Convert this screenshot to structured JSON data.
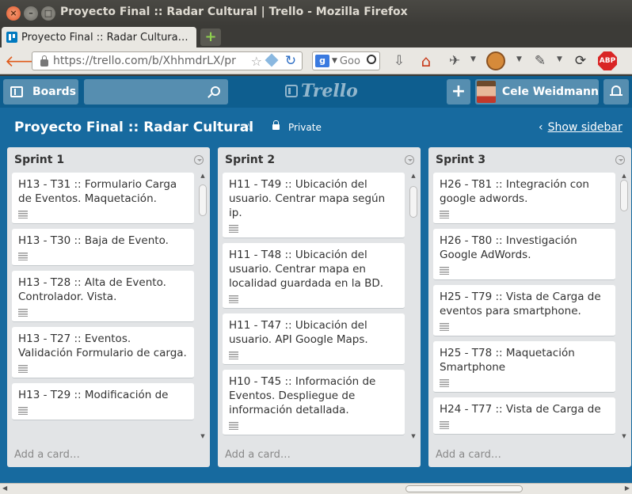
{
  "window": {
    "title": "Proyecto Final :: Radar Cultural | Trello - Mozilla Firefox",
    "close": "×",
    "minimize": "–",
    "maximize": "□"
  },
  "browser": {
    "tab_title": "Proyecto Final :: Radar Cultura…",
    "new_tab": "+",
    "back": "🡐",
    "url": "https://trello.com/b/XhhmdrLX/pr",
    "search_engine": "g",
    "search_dropdown": "▼",
    "search_text": "Goo",
    "star": "☆",
    "reload": "↻",
    "download": "⇩",
    "home": "⌂",
    "adblock": "ABP",
    "icons": [
      "back-arrow-icon",
      "lock-icon",
      "bookmark-star-icon",
      "cube-icon",
      "reload-icon",
      "google-icon",
      "download-icon",
      "home-icon",
      "satellite-icon",
      "monkey-icon",
      "eyedropper-icon",
      "sync-icon",
      "adblock-icon"
    ]
  },
  "trello_header": {
    "boards_label": "Boards",
    "logo_text": "Trello",
    "add_label": "+",
    "user_name": "Cele Weidmann"
  },
  "board": {
    "title": "Proyecto Final :: Radar Cultural",
    "star": "☆",
    "visibility": "Private",
    "show_sidebar": "Show sidebar",
    "chevron": "‹",
    "add_card": "Add a card…",
    "colors": {
      "header_bg": "#0e5e8f",
      "board_bg": "#176a9f",
      "list_bg": "#e2e4e6"
    },
    "lists": [
      {
        "name": "Sprint 1",
        "scroll_fraction": 0.02,
        "cards": [
          "H13 - T31 :: Formulario Carga de Eventos. Maquetación.",
          "H13 - T30 :: Baja de Evento.",
          "H13 - T28 :: Alta de Evento. Controlador. Vista.",
          "H13 - T27 :: Eventos. Validación Formulario de carga.",
          "H13 - T29 :: Modificación de"
        ]
      },
      {
        "name": "Sprint 2",
        "scroll_fraction": 0.03,
        "cards": [
          "H11 - T49 :: Ubicación del usuario. Centrar mapa según ip.",
          "H11 - T48 :: Ubicación del usuario. Centrar mapa en localidad guardada en la BD.",
          "H11 - T47 :: Ubicación del usuario. API Google Maps.",
          "H10 - T45 :: Información de Eventos. Despliegue de información detallada."
        ]
      },
      {
        "name": "Sprint 3",
        "scroll_fraction": 0.0,
        "cards": [
          "H26 - T81 :: Integración con google adwords.",
          "H26 - T80 :: Investigación Google AdWords.",
          "H25 - T79 :: Vista de Carga de eventos para smartphone.",
          "H25 - T78 :: Maquetación Smartphone",
          "H24 - T77 :: Vista de Carga de"
        ]
      }
    ]
  },
  "hscroll": {
    "left": "◀",
    "right": "▶"
  }
}
